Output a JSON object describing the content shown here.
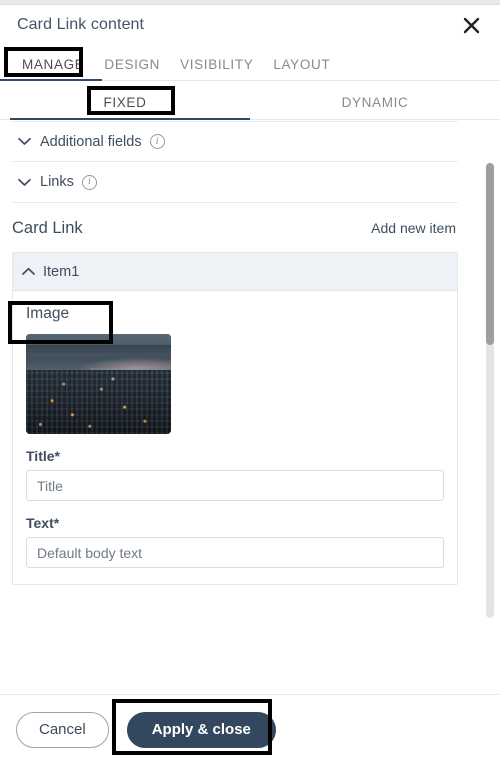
{
  "dialog": {
    "title": "Card Link content",
    "close_icon": "close-icon"
  },
  "tabs_primary": [
    {
      "label": "MANAGE",
      "active": true
    },
    {
      "label": "DESIGN",
      "active": false
    },
    {
      "label": "VISIBILITY",
      "active": false
    },
    {
      "label": "LAYOUT",
      "active": false
    }
  ],
  "tabs_sub": [
    {
      "label": "FIXED",
      "active": true
    },
    {
      "label": "DYNAMIC",
      "active": false
    }
  ],
  "sections": [
    {
      "label": "Additional fields",
      "chevron": "chevron-down-icon",
      "info": "info-icon"
    },
    {
      "label": "Links",
      "chevron": "chevron-down-icon",
      "info": "info-icon"
    }
  ],
  "list": {
    "title": "Card Link",
    "add_new_label": "Add new item"
  },
  "item": {
    "title": "Item1",
    "chevron": "chevron-up-icon",
    "image_heading": "Image",
    "image_alt": "city-skyline-at-dusk-thumbnail",
    "fields": [
      {
        "label": "Title*",
        "value": "",
        "placeholder": "Title"
      },
      {
        "label": "Text*",
        "value": "",
        "placeholder": "Default body text"
      }
    ]
  },
  "footer": {
    "cancel_label": "Cancel",
    "apply_label": "Apply & close"
  },
  "colors": {
    "accent": "#2f4a66",
    "primary_button": "#33475e",
    "item_header_bg": "#eef1f6",
    "annotation": "#000000",
    "text": "#3f4d5e",
    "muted_text": "#8a8a8a"
  }
}
